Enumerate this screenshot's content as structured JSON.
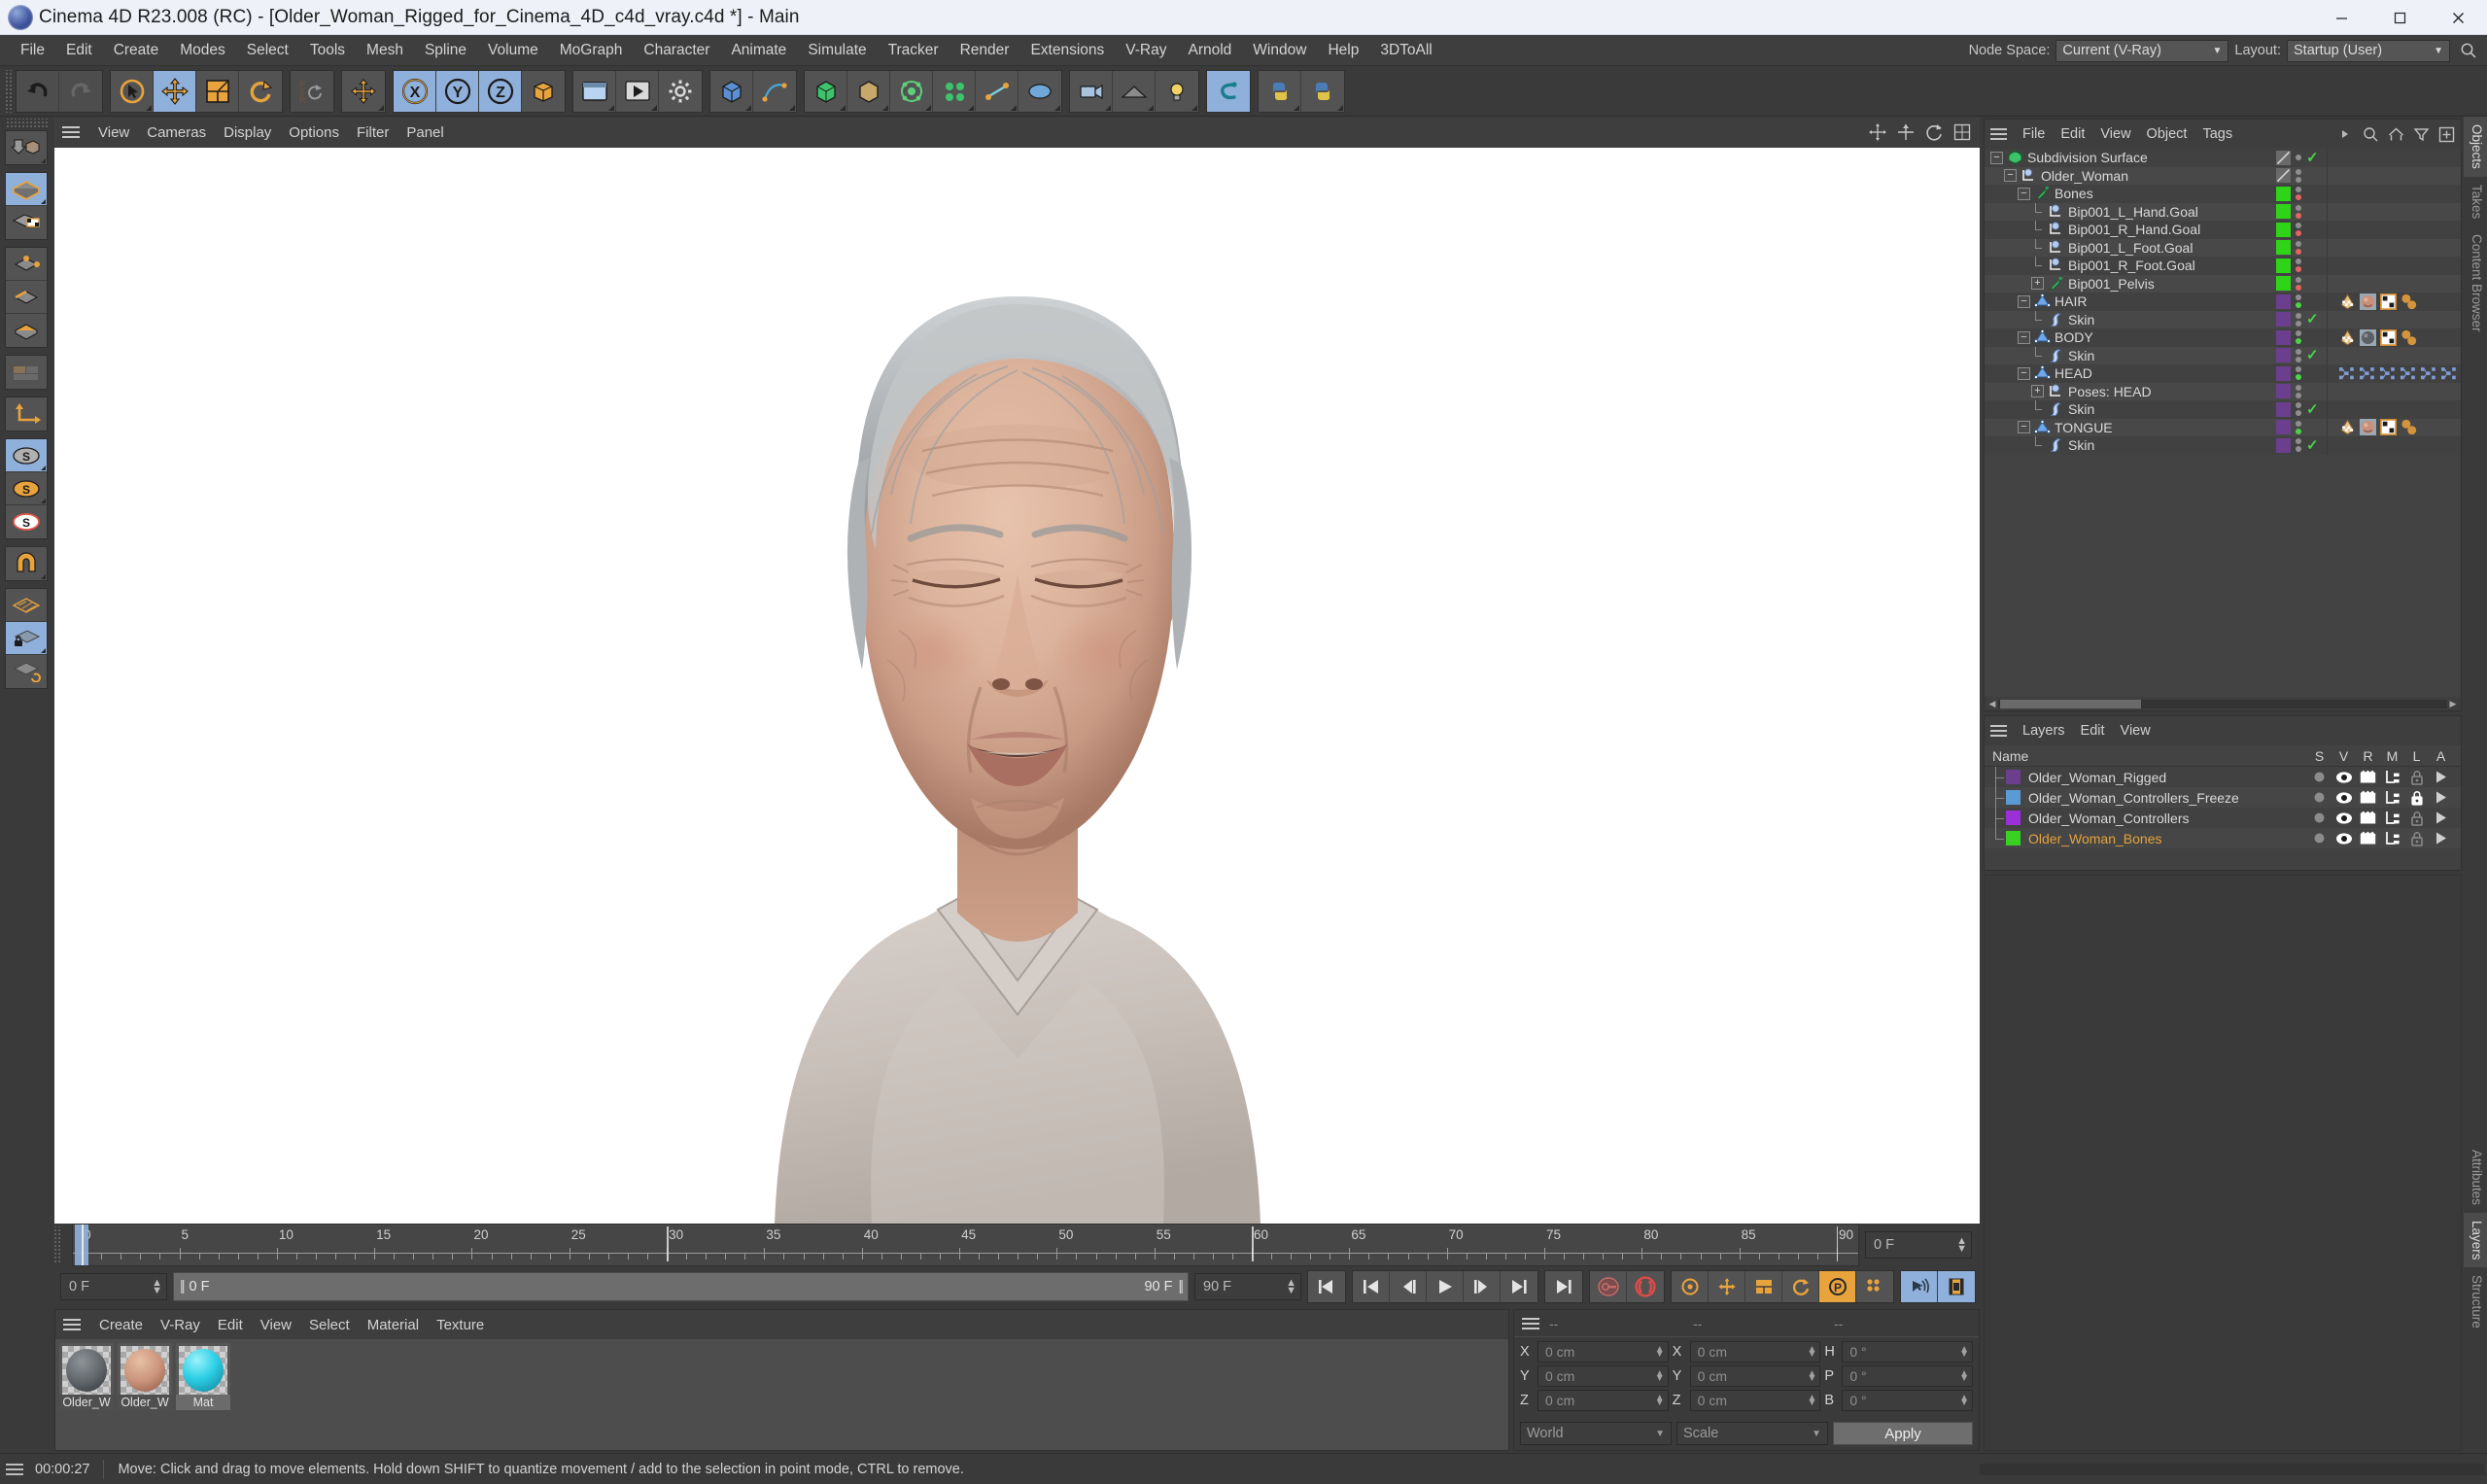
{
  "window": {
    "title": "Cinema 4D R23.008 (RC) - [Older_Woman_Rigged_for_Cinema_4D_c4d_vray.c4d *] - Main",
    "minimize": "─",
    "maximize": "❐",
    "close": "✕"
  },
  "menubar": {
    "items": [
      "File",
      "Edit",
      "Create",
      "Modes",
      "Select",
      "Tools",
      "Mesh",
      "Spline",
      "Volume",
      "MoGraph",
      "Character",
      "Animate",
      "Simulate",
      "Tracker",
      "Render",
      "Extensions",
      "V-Ray",
      "Arnold",
      "Window",
      "Help",
      "3DToAll"
    ],
    "node_space_label": "Node Space:",
    "node_space_value": "Current (V-Ray)",
    "layout_label": "Layout:",
    "layout_value": "Startup (User)"
  },
  "viewport": {
    "menus": [
      "View",
      "Cameras",
      "Display",
      "Options",
      "Filter",
      "Panel"
    ]
  },
  "timeline": {
    "ticks": [
      0,
      5,
      10,
      15,
      20,
      25,
      30,
      35,
      40,
      45,
      50,
      55,
      60,
      65,
      70,
      75,
      80,
      85,
      90
    ],
    "min_frame": 0,
    "max_frame": 90,
    "current_frame_field": "0 F",
    "end_frame_field": "0 F",
    "preview_min_field": "0 F",
    "preview_max_field": "90 F",
    "doc_end_field": "90 F"
  },
  "materials": {
    "menus": [
      "Create",
      "V-Ray",
      "Edit",
      "View",
      "Select",
      "Material",
      "Texture"
    ],
    "items": [
      {
        "label": "Older_W",
        "color": "#6b6f74"
      },
      {
        "label": "Older_W",
        "color": "#c99a84"
      },
      {
        "label": "Mat",
        "color": "#2ed0e6"
      }
    ]
  },
  "coordinates": {
    "header_dashes": [
      "--",
      "--",
      "--"
    ],
    "position": {
      "label_x": "X",
      "label_y": "Y",
      "label_z": "Z",
      "x": "0 cm",
      "y": "0 cm",
      "z": "0 cm"
    },
    "size": {
      "label_x": "X",
      "label_y": "Y",
      "label_z": "Z",
      "x": "0 cm",
      "y": "0 cm",
      "z": "0 cm"
    },
    "rotation": {
      "label_h": "H",
      "label_p": "P",
      "label_b": "B",
      "h": "0 °",
      "p": "0 °",
      "b": "0 °"
    },
    "coord_system": "World",
    "mode": "Scale",
    "apply": "Apply"
  },
  "objects_panel": {
    "menus": [
      "File",
      "Edit",
      "View",
      "Object",
      "Tags"
    ],
    "tree": [
      {
        "label": "Subdivision Surface",
        "depth": 0,
        "expander": "minus",
        "icon": "subdivision-surface-icon",
        "swatch": "diagonal",
        "dots": [
          "grey"
        ],
        "check": true,
        "tags": []
      },
      {
        "label": "Older_Woman",
        "depth": 1,
        "expander": "minus",
        "icon": "null-object-icon",
        "swatch": "diagonal",
        "dots": [
          "grey",
          "grey"
        ],
        "check": false,
        "tags": []
      },
      {
        "label": "Bones",
        "depth": 2,
        "expander": "minus",
        "icon": "joint-icon",
        "swatch": "#2fd419",
        "dots": [
          "grey",
          "red"
        ],
        "check": false,
        "tags": []
      },
      {
        "label": "Bip001_L_Hand.Goal",
        "depth": 3,
        "expander": "none",
        "icon": "null-object-icon",
        "swatch": "#2fd419",
        "dots": [
          "grey",
          "red"
        ],
        "check": false,
        "tags": []
      },
      {
        "label": "Bip001_R_Hand.Goal",
        "depth": 3,
        "expander": "none",
        "icon": "null-object-icon",
        "swatch": "#2fd419",
        "dots": [
          "grey",
          "red"
        ],
        "check": false,
        "tags": []
      },
      {
        "label": "Bip001_L_Foot.Goal",
        "depth": 3,
        "expander": "none",
        "icon": "null-object-icon",
        "swatch": "#2fd419",
        "dots": [
          "grey",
          "red"
        ],
        "check": false,
        "tags": []
      },
      {
        "label": "Bip001_R_Foot.Goal",
        "depth": 3,
        "expander": "none",
        "icon": "null-object-icon",
        "swatch": "#2fd419",
        "dots": [
          "grey",
          "red"
        ],
        "check": false,
        "tags": []
      },
      {
        "label": "Bip001_Pelvis",
        "depth": 3,
        "expander": "plus",
        "icon": "joint-icon",
        "swatch": "#2fd419",
        "dots": [
          "grey",
          "red"
        ],
        "check": false,
        "tags": []
      },
      {
        "label": "HAIR",
        "depth": 2,
        "expander": "minus",
        "icon": "polygon-object-icon",
        "swatch": "#6b3f8e",
        "dots": [
          "grey",
          "green"
        ],
        "check": false,
        "tags": [
          "phong-tag",
          "material-skin-tag",
          "uvw-tag",
          "selection-tag"
        ]
      },
      {
        "label": "Skin",
        "depth": 3,
        "expander": "none",
        "icon": "skin-deformer-icon",
        "swatch": "#6b3f8e",
        "dots": [
          "grey",
          "grey"
        ],
        "check": true,
        "tags": []
      },
      {
        "label": "BODY",
        "depth": 2,
        "expander": "minus",
        "icon": "polygon-object-icon",
        "swatch": "#6b3f8e",
        "dots": [
          "grey",
          "green"
        ],
        "check": false,
        "tags": [
          "phong-tag",
          "material-cloth-tag",
          "uvw-tag",
          "selection-tag"
        ]
      },
      {
        "label": "Skin",
        "depth": 3,
        "expander": "none",
        "icon": "skin-deformer-icon",
        "swatch": "#6b3f8e",
        "dots": [
          "grey",
          "grey"
        ],
        "check": true,
        "tags": []
      },
      {
        "label": "HEAD",
        "depth": 2,
        "expander": "minus",
        "icon": "polygon-object-icon",
        "swatch": "#6b3f8e",
        "dots": [
          "grey",
          "green"
        ],
        "check": false,
        "tags": [
          "pose-morph-tag",
          "pose-morph-tag",
          "pose-morph-tag",
          "pose-morph-tag",
          "pose-morph-tag",
          "pose-morph-tag",
          "pose-morph-tag",
          "pose-morph-tag"
        ]
      },
      {
        "label": "Poses: HEAD",
        "depth": 3,
        "expander": "plus",
        "icon": "null-object-icon",
        "swatch": "#6b3f8e",
        "dots": [
          "grey",
          "grey"
        ],
        "check": false,
        "tags": []
      },
      {
        "label": "Skin",
        "depth": 3,
        "expander": "none",
        "icon": "skin-deformer-icon",
        "swatch": "#6b3f8e",
        "dots": [
          "grey",
          "grey"
        ],
        "check": true,
        "tags": []
      },
      {
        "label": "TONGUE",
        "depth": 2,
        "expander": "minus",
        "icon": "polygon-object-icon",
        "swatch": "#6b3f8e",
        "dots": [
          "grey",
          "green"
        ],
        "check": false,
        "tags": [
          "phong-tag",
          "material-skin-tag",
          "uvw-tag",
          "selection-tag"
        ]
      },
      {
        "label": "Skin",
        "depth": 3,
        "expander": "none",
        "icon": "skin-deformer-icon",
        "swatch": "#6b3f8e",
        "dots": [
          "grey",
          "grey"
        ],
        "check": true,
        "tags": []
      }
    ],
    "side_tabs": [
      "Objects",
      "Takes",
      "Content Browser"
    ]
  },
  "layers_panel": {
    "menus": [
      "Layers",
      "Edit",
      "View"
    ],
    "name_header": "Name",
    "columns": [
      "S",
      "V",
      "R",
      "M",
      "L",
      "A"
    ],
    "rows": [
      {
        "label": "Older_Woman_Rigged",
        "color": "#6b3f8e",
        "highlight": false,
        "locked": false
      },
      {
        "label": "Older_Woman_Controllers_Freeze",
        "color": "#5b9bd5",
        "highlight": false,
        "locked": true
      },
      {
        "label": "Older_Woman_Controllers",
        "color": "#9b30d9",
        "highlight": false,
        "locked": false
      },
      {
        "label": "Older_Woman_Bones",
        "color": "#39d122",
        "highlight": true,
        "locked": false
      }
    ],
    "side_tabs": [
      "Attributes",
      "Layers",
      "Structure"
    ]
  },
  "statusbar": {
    "time": "00:00:27",
    "message": "Move: Click and drag to move elements. Hold down SHIFT to quantize movement / add to the selection in point mode, CTRL to remove."
  },
  "colors": {
    "accent_orange": "#e8a33d",
    "selection_blue": "#8fb0da",
    "panel_bg": "#3a3a3a",
    "highlight_text": "#e5a23c"
  }
}
